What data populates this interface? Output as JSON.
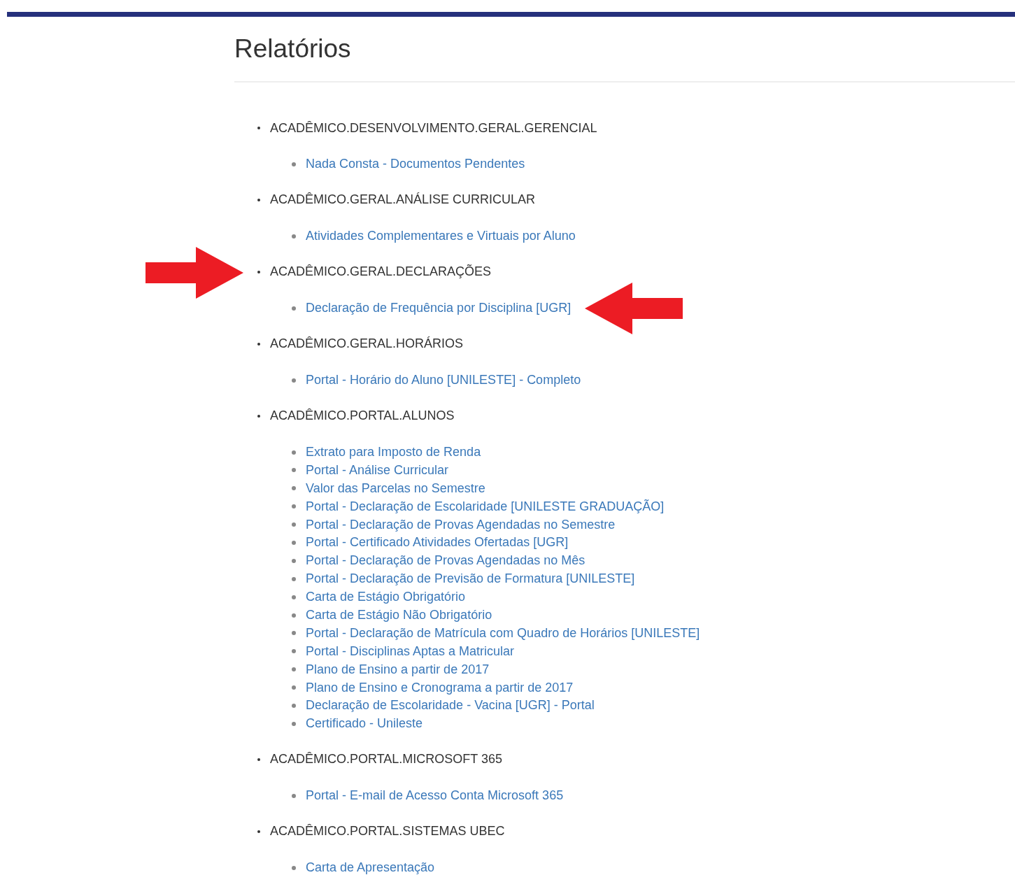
{
  "page": {
    "title": "Relatórios"
  },
  "groups": [
    {
      "name": "ACADÊMICO.DESENVOLVIMENTO.GERAL.GERENCIAL",
      "highlighted": false,
      "links": [
        {
          "label": "Nada Consta - Documentos Pendentes",
          "highlighted": false
        }
      ]
    },
    {
      "name": "ACADÊMICO.GERAL.ANÁLISE CURRICULAR",
      "highlighted": false,
      "links": [
        {
          "label": "Atividades Complementares e Virtuais por Aluno",
          "highlighted": false
        }
      ]
    },
    {
      "name": "ACADÊMICO.GERAL.DECLARAÇÕES",
      "highlighted": true,
      "links": [
        {
          "label": "Declaração de Frequência por Disciplina [UGR]",
          "highlighted": true
        }
      ]
    },
    {
      "name": "ACADÊMICO.GERAL.HORÁRIOS",
      "highlighted": false,
      "links": [
        {
          "label": "Portal - Horário do Aluno [UNILESTE] - Completo",
          "highlighted": false
        }
      ]
    },
    {
      "name": "ACADÊMICO.PORTAL.ALUNOS",
      "highlighted": false,
      "links": [
        {
          "label": "Extrato para Imposto de Renda",
          "highlighted": false
        },
        {
          "label": "Portal - Análise Curricular",
          "highlighted": false
        },
        {
          "label": "Valor das Parcelas no Semestre",
          "highlighted": false
        },
        {
          "label": "Portal - Declaração de Escolaridade [UNILESTE GRADUAÇÃO]",
          "highlighted": false
        },
        {
          "label": "Portal - Declaração de Provas Agendadas no Semestre",
          "highlighted": false
        },
        {
          "label": "Portal - Certificado Atividades Ofertadas [UGR]",
          "highlighted": false
        },
        {
          "label": "Portal - Declaração de Provas Agendadas no Mês",
          "highlighted": false
        },
        {
          "label": "Portal - Declaração de Previsão de Formatura [UNILESTE]",
          "highlighted": false
        },
        {
          "label": "Carta de Estágio Obrigatório",
          "highlighted": false
        },
        {
          "label": "Carta de Estágio Não Obrigatório",
          "highlighted": false
        },
        {
          "label": "Portal - Declaração de Matrícula com Quadro de Horários [UNILESTE]",
          "highlighted": false
        },
        {
          "label": "Portal - Disciplinas Aptas a Matricular",
          "highlighted": false
        },
        {
          "label": "Plano de Ensino a partir de 2017",
          "highlighted": false
        },
        {
          "label": "Plano de Ensino e Cronograma a partir de 2017",
          "highlighted": false
        },
        {
          "label": "Declaração de Escolaridade - Vacina [UGR] - Portal",
          "highlighted": false
        },
        {
          "label": "Certificado - Unileste",
          "highlighted": false
        }
      ]
    },
    {
      "name": "ACADÊMICO.PORTAL.MICROSOFT 365",
      "highlighted": false,
      "links": [
        {
          "label": "Portal - E-mail de Acesso Conta Microsoft 365",
          "highlighted": false
        }
      ]
    },
    {
      "name": "ACADÊMICO.PORTAL.SISTEMAS UBEC",
      "highlighted": false,
      "links": [
        {
          "label": "Carta de Apresentação",
          "highlighted": false
        }
      ]
    }
  ]
}
